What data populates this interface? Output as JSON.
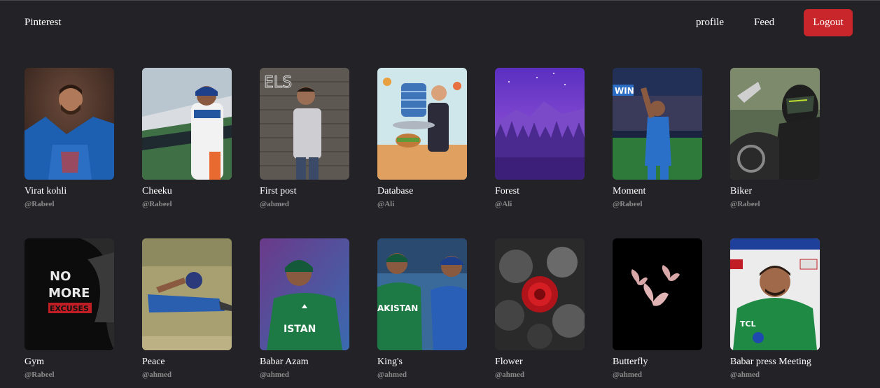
{
  "nav": {
    "brand": "Pinterest",
    "links": [
      "profile",
      "Feed"
    ],
    "logout_label": "Logout",
    "logout_color": "#c8262a"
  },
  "posts": [
    {
      "title": "Virat kohli",
      "user": "@Rabeel",
      "image": "cricketer-celebrating-blue-jersey"
    },
    {
      "title": "Cheeku",
      "user": "@Rabeel",
      "image": "cricketer-walking-stadium"
    },
    {
      "title": "First post",
      "user": "@ahmed",
      "image": "man-against-brick-wall"
    },
    {
      "title": "Database",
      "user": "@Ali",
      "image": "waiter-serving-database-illustration"
    },
    {
      "title": "Forest",
      "user": "@Ali",
      "image": "purple-forest-mountain"
    },
    {
      "title": "Moment",
      "user": "@Rabeel",
      "image": "cricketer-stadium-wave"
    },
    {
      "title": "Biker",
      "user": "@Rabeel",
      "image": "motorcycle-helmet-rider"
    },
    {
      "title": "Gym",
      "user": "@Rabeel",
      "image": "no-more-excuses-poster",
      "poster_text": [
        "NO",
        "MORE",
        "EXCUSES"
      ]
    },
    {
      "title": "Peace",
      "user": "@ahmed",
      "image": "cricketer-lying-on-grass"
    },
    {
      "title": "Babar Azam",
      "user": "@ahmed",
      "image": "cricketer-green-jersey"
    },
    {
      "title": "King's",
      "user": "@ahmed",
      "image": "two-cricketers-talking"
    },
    {
      "title": "Flower",
      "user": "@ahmed",
      "image": "red-rose-black-white"
    },
    {
      "title": "Butterfly",
      "user": "@ahmed",
      "image": "pink-butterflies-black"
    },
    {
      "title": "Babar press Meeting",
      "user": "@ahmed",
      "image": "cricketer-press-conference"
    }
  ]
}
